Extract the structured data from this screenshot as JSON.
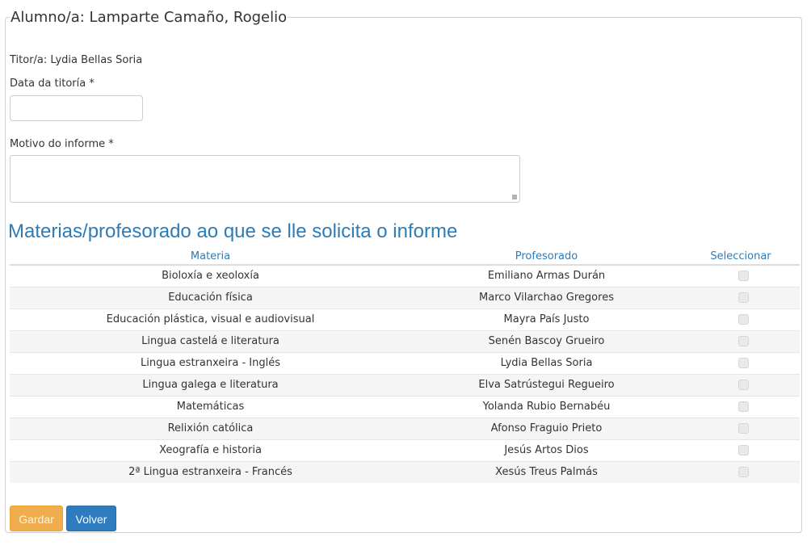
{
  "form": {
    "legend": "Alumno/a: Lamparte Camaño, Rogelio",
    "tutor_line": "Titor/a: Lydia Bellas Soria",
    "date_label": "Data da titoría *",
    "date_value": "",
    "reason_label": "Motivo do informe *",
    "reason_value": ""
  },
  "section": {
    "title": "Materias/profesorado ao que se lle solicita o informe"
  },
  "table": {
    "headers": {
      "subject": "Materia",
      "teacher": "Profesorado",
      "select": "Seleccionar"
    },
    "rows": [
      {
        "subject": "Bioloxía e xeoloxía",
        "teacher": "Emiliano Armas Durán",
        "selected": false
      },
      {
        "subject": "Educación física",
        "teacher": "Marco Vilarchao Gregores",
        "selected": false
      },
      {
        "subject": "Educación plástica, visual e audiovisual",
        "teacher": "Mayra País Justo",
        "selected": false
      },
      {
        "subject": "Lingua castelá e literatura",
        "teacher": "Senén Bascoy Grueiro",
        "selected": false
      },
      {
        "subject": "Lingua estranxeira - Inglés",
        "teacher": "Lydia Bellas Soria",
        "selected": false
      },
      {
        "subject": "Lingua galega e literatura",
        "teacher": "Elva Satrústegui Regueiro",
        "selected": false
      },
      {
        "subject": "Matemáticas",
        "teacher": "Yolanda Rubio Bernabéu",
        "selected": false
      },
      {
        "subject": "Relixión católica",
        "teacher": "Afonso Fraguio Prieto",
        "selected": false
      },
      {
        "subject": "Xeografía e historia",
        "teacher": "Jesús Artos Dios",
        "selected": false
      },
      {
        "subject": "2ª Lingua estranxeira - Francés",
        "teacher": "Xesús Treus Palmás",
        "selected": false
      }
    ]
  },
  "buttons": {
    "save_label": "Gardar",
    "back_label": "Volver"
  },
  "colors": {
    "accent_blue": "#2c7cb8",
    "save_orange": "#f0ad4e",
    "back_blue": "#2f7bbf"
  }
}
